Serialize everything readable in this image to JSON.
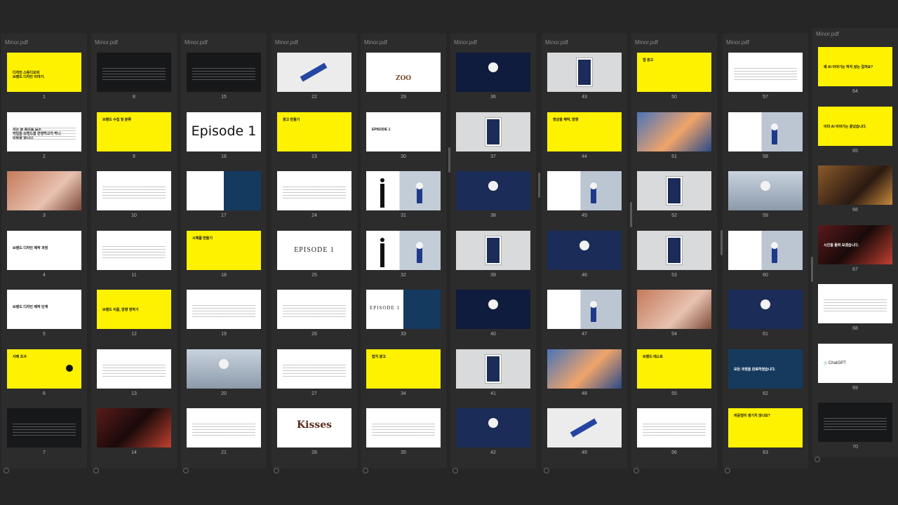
{
  "columns": [
    {
      "title": "Minor.pdf",
      "pages": [
        {
          "n": "1",
          "style": "yellow",
          "text": "디자인 스튜디오의\n브랜드 디자인 이야기."
        },
        {
          "n": "2",
          "style": "white",
          "text": "저는 늘 흥미로 보는\n파일들 브랜드를 한정하고자 하니\n미팅을 합니다."
        },
        {
          "n": "3",
          "style": "photo",
          "text": ""
        },
        {
          "n": "4",
          "style": "white",
          "text": "브랜드 디자인 제작 과정"
        },
        {
          "n": "5",
          "style": "white",
          "text": "브랜드 디자인 제작 단계"
        },
        {
          "n": "6",
          "style": "yellow",
          "text": "사례 조사"
        },
        {
          "n": "7",
          "style": "dark",
          "text": ""
        }
      ]
    },
    {
      "title": "Minor.pdf",
      "pages": [
        {
          "n": "8",
          "style": "dark",
          "text": ""
        },
        {
          "n": "9",
          "style": "yellow",
          "text": "브랜드 수집 및 분류"
        },
        {
          "n": "10",
          "style": "white",
          "text": ""
        },
        {
          "n": "11",
          "style": "white",
          "text": ""
        },
        {
          "n": "12",
          "style": "yellow",
          "text": "브랜드 이름, 방향 정하기"
        },
        {
          "n": "13",
          "style": "white",
          "text": ""
        },
        {
          "n": "14",
          "style": "redpic",
          "text": ""
        }
      ]
    },
    {
      "title": "Minor.pdf",
      "pages": [
        {
          "n": "15",
          "style": "dark",
          "text": ""
        },
        {
          "n": "16",
          "style": "episode",
          "text": "Episode 1"
        },
        {
          "n": "17",
          "style": "splitnavy",
          "text": ""
        },
        {
          "n": "18",
          "style": "yellow",
          "text": "시제품 만들기"
        },
        {
          "n": "19",
          "style": "white",
          "text": ""
        },
        {
          "n": "20",
          "style": "sky",
          "text": ""
        },
        {
          "n": "21",
          "style": "white",
          "text": ""
        }
      ]
    },
    {
      "title": "Minor.pdf",
      "pages": [
        {
          "n": "22",
          "style": "stick",
          "text": ""
        },
        {
          "n": "23",
          "style": "yellow",
          "text": "광고 만들기"
        },
        {
          "n": "24",
          "style": "white",
          "text": ""
        },
        {
          "n": "25",
          "style": "episodeserif",
          "text": "EPISODE 1"
        },
        {
          "n": "26",
          "style": "white",
          "text": ""
        },
        {
          "n": "27",
          "style": "white",
          "text": ""
        },
        {
          "n": "28",
          "style": "kisses",
          "text": "Kisses"
        }
      ]
    },
    {
      "title": "Minor.pdf",
      "pages": [
        {
          "n": "29",
          "style": "zoo",
          "text": "ZOO"
        },
        {
          "n": "30",
          "style": "white",
          "text": "EPISODE 1"
        },
        {
          "n": "31",
          "style": "iprod",
          "text": ""
        },
        {
          "n": "32",
          "style": "iprod",
          "text": ""
        },
        {
          "n": "33",
          "style": "splitepisode",
          "text": "EPISODE 1"
        },
        {
          "n": "34",
          "style": "yellow",
          "text": "잡지 광고"
        },
        {
          "n": "35",
          "style": "white",
          "text": ""
        }
      ]
    },
    {
      "title": "Minor.pdf",
      "pages": [
        {
          "n": "36",
          "style": "darknavy",
          "text": ""
        },
        {
          "n": "37",
          "style": "phonegray",
          "text": ""
        },
        {
          "n": "38",
          "style": "navy",
          "text": ""
        },
        {
          "n": "39",
          "style": "phonegray",
          "text": ""
        },
        {
          "n": "40",
          "style": "darknavy",
          "text": ""
        },
        {
          "n": "41",
          "style": "phonegray",
          "text": ""
        },
        {
          "n": "42",
          "style": "navy",
          "text": ""
        }
      ]
    },
    {
      "title": "Minor.pdf",
      "pages": [
        {
          "n": "43",
          "style": "phonegray",
          "text": ""
        },
        {
          "n": "44",
          "style": "yellow",
          "text": "영상을 제작, 방향"
        },
        {
          "n": "45",
          "style": "splitgray",
          "text": ""
        },
        {
          "n": "46",
          "style": "navy",
          "text": ""
        },
        {
          "n": "47",
          "style": "splitgray",
          "text": ""
        },
        {
          "n": "48",
          "style": "bluephoto",
          "text": ""
        },
        {
          "n": "49",
          "style": "stick",
          "text": ""
        }
      ]
    },
    {
      "title": "Minor.pdf",
      "pages": [
        {
          "n": "50",
          "style": "yellow",
          "text": "앱 광고"
        },
        {
          "n": "51",
          "style": "bluephoto",
          "text": ""
        },
        {
          "n": "52",
          "style": "phonegray",
          "text": ""
        },
        {
          "n": "53",
          "style": "phonegray",
          "text": ""
        },
        {
          "n": "54",
          "style": "photo",
          "text": ""
        },
        {
          "n": "55",
          "style": "yellow",
          "text": "브랜드 테스트"
        },
        {
          "n": "56",
          "style": "white",
          "text": ""
        }
      ]
    },
    {
      "title": "Minor.pdf",
      "pages": [
        {
          "n": "57",
          "style": "white",
          "text": ""
        },
        {
          "n": "58",
          "style": "splitgray",
          "text": ""
        },
        {
          "n": "59",
          "style": "sky",
          "text": ""
        },
        {
          "n": "60",
          "style": "splitgray",
          "text": ""
        },
        {
          "n": "61",
          "style": "navy",
          "text": ""
        },
        {
          "n": "62",
          "style": "blue",
          "text": "모든 과정을 완료하였습니다."
        },
        {
          "n": "63",
          "style": "yellow",
          "text": "의문점이 생기지 않나요?"
        }
      ]
    },
    {
      "title": "Minor.pdf",
      "pages": [
        {
          "n": "64",
          "style": "yellow",
          "text": "왜 AI 이야기는 하지 않는 걸까요?"
        },
        {
          "n": "65",
          "style": "yellow",
          "text": "이미 AI 이야기는 끝났습니다."
        },
        {
          "n": "66",
          "style": "gold",
          "text": ""
        },
        {
          "n": "67",
          "style": "redpic",
          "text": "시간을 돌려 보겠습니다."
        },
        {
          "n": "68",
          "style": "white",
          "text": ""
        },
        {
          "n": "69",
          "style": "chatgpt",
          "text": "ChatGPT"
        },
        {
          "n": "70",
          "style": "dark",
          "text": ""
        }
      ]
    }
  ]
}
